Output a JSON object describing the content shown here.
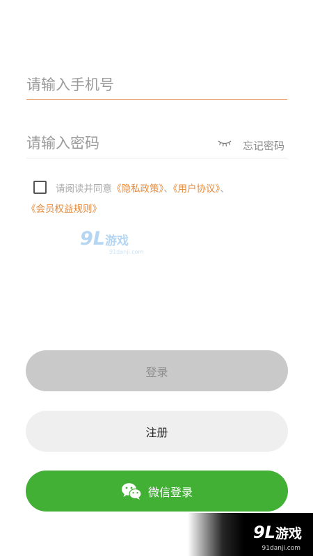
{
  "form": {
    "phone_placeholder": "请输入手机号",
    "password_placeholder": "请输入密码",
    "forgot_label": "忘记密码"
  },
  "agreement": {
    "prefix": "请阅读并同意",
    "privacy": "《隐私政策》",
    "sep1": "、",
    "user_agreement": "《用户协议》",
    "sep2": "、",
    "member_rules": "《会员权益规则》"
  },
  "buttons": {
    "login": "登录",
    "register": "注册",
    "wechat_login": "微信登录"
  },
  "watermark": {
    "logo_num": "9L",
    "logo_cn": "游戏",
    "logo_sub": "91danji.com"
  },
  "colors": {
    "accent_orange": "#e58a3c",
    "wechat_green": "#41b035",
    "login_disabled": "#c9c9c9"
  },
  "icons": {
    "password_toggle": "eye-closed-icon",
    "wechat": "wechat-icon"
  }
}
